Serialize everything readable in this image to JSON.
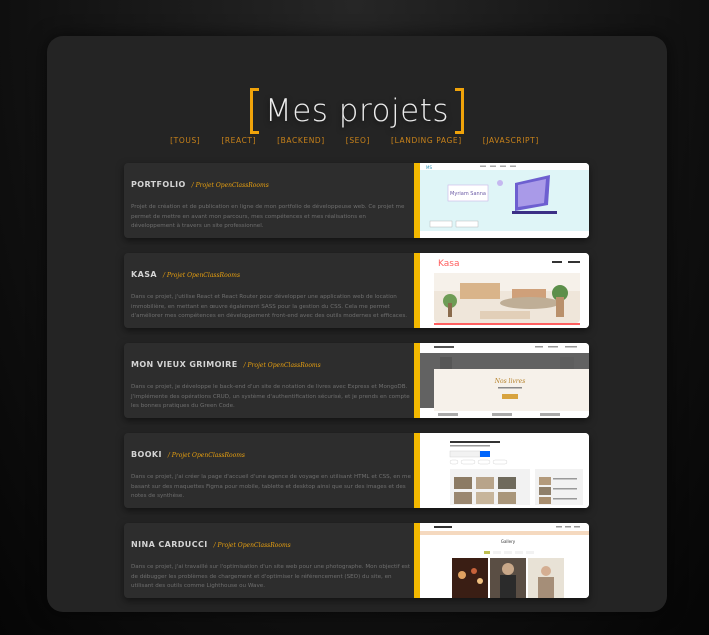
{
  "title": "Mes projets",
  "filters": [
    "[TOUS]",
    "[REACT]",
    "[BACKEND]",
    "[SEO]",
    "[LANDING PAGE]",
    "[JAVASCRIPT]"
  ],
  "projects": [
    {
      "name": "PORTFOLIO",
      "tag": "/ Projet OpenClassRooms",
      "description": "Projet de création et de publication en ligne de mon portfolio de développeuse web. Ce projet me permet de mettre en avant mon parcours, mes compétences et mes réalisations en développement à travers un site professionnel.",
      "thumb": "portfolio-preview"
    },
    {
      "name": "KASA",
      "tag": "/ Projet OpenClassRooms",
      "description": "Dans ce projet, j'utilise React et React Router pour développer une application web de location immobilière, en mettant en œuvre également SASS pour la gestion du CSS. Cela me permet d'améliorer mes compétences en développement front-end avec des outils modernes et efficaces.",
      "thumb": "kasa-preview"
    },
    {
      "name": "MON VIEUX GRIMOIRE",
      "tag": "/ Projet OpenClassRooms",
      "description": "Dans ce projet, je développe le back-end d'un site de notation de livres avec Express et MongoDB. J'implémente des opérations CRUD, un système d'authentification sécurisé, et je prends en compte les bonnes pratiques du Green Code.",
      "thumb": "grimoire-preview"
    },
    {
      "name": "BOOKI",
      "tag": "/ Projet OpenClassRooms",
      "description": "Dans ce projet, j'ai créer la page d'accueil d'une agence de voyage en utilisant HTML et CSS, en me basant sur des maquettes Figma pour mobile, tablette et desktop ainsi que sur des images et des notes de synthèse.",
      "thumb": "booki-preview"
    },
    {
      "name": "NINA CARDUCCI",
      "tag": "/ Projet OpenClassRooms",
      "description": "Dans ce projet, j'ai travaillé sur l'optimisation d'un site web pour une photographe. Mon objectif est de débugger les problèmes de chargement et d'optimiser le référencement (SEO) du site, en utilisant des outils comme Lighthouse ou Wave.",
      "thumb": "nina-preview"
    }
  ],
  "thumbs": {
    "portfolio_name": "Myriam Sanna",
    "kasa_logo": "Kasa",
    "grimoire_heading": "Nos livres",
    "nina_heading": "Gallery"
  },
  "colors": {
    "accent": "#f0a30a",
    "card": "#2d2d2d",
    "bar": "#f3b800"
  }
}
